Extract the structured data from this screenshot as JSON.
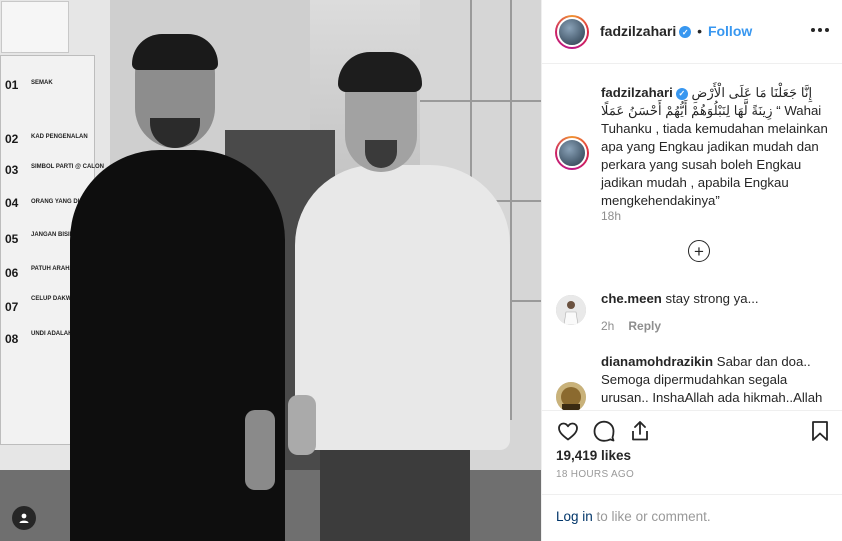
{
  "post": {
    "username": "fadzilzahari",
    "verified_mark": "✓",
    "separator": "•",
    "follow_label": "Follow",
    "caption_arabic": "إِنَّا جَعَلْنَا مَا عَلَى الْأَرْضِ زِينَةً لَّهَا لِنَبْلُوَهُمْ أَيُّهُمْ أَحْسَنُ عَمَلًا",
    "caption_text": "“ Wahai Tuhanku , tiada kemudahan melainkan apa yang Engkau jadikan mudah dan perkara yang susah boleh Engkau jadikan mudah , apabila Engkau mengkehendakinya”",
    "caption_time": "18h",
    "load_more_symbol": "+",
    "likes": "19,419 likes",
    "post_date": "18 HOURS AGO",
    "login_link": "Log in",
    "login_rest": " to like or comment."
  },
  "comments": [
    {
      "username": "che.meen",
      "text": "stay strong ya...",
      "time": "2h",
      "reply_label": "Reply"
    },
    {
      "username": "dianamohdrazikin",
      "text": "Sabar dan doa.. Semoga dipermudahkan segala urusan.. InshaAllah ada hikmah..Allah",
      "time": "",
      "reply_label": ""
    }
  ],
  "photo_poster": {
    "rows": [
      "01",
      "02",
      "03",
      "04",
      "05",
      "06",
      "07",
      "08"
    ],
    "labels": [
      "SEMAK",
      "KAD PENGENALAN",
      "SIMBOL PARTI @ CALON",
      "ORANG YANG DI",
      "JANGAN BISING",
      "PATUH ARAHAN",
      "CELUP DAKWAT",
      "UNDI ADALAH"
    ]
  },
  "icons": {
    "like": "heart-icon",
    "comment": "comment-icon",
    "share": "share-icon",
    "save": "bookmark-icon",
    "tagged": "user-tag-icon",
    "more": "more-options-icon",
    "load_more": "plus-circle-icon"
  },
  "colors": {
    "link_blue": "#3897f0",
    "text": "#262626",
    "muted": "#8e8e8e",
    "login_link": "#003569"
  }
}
